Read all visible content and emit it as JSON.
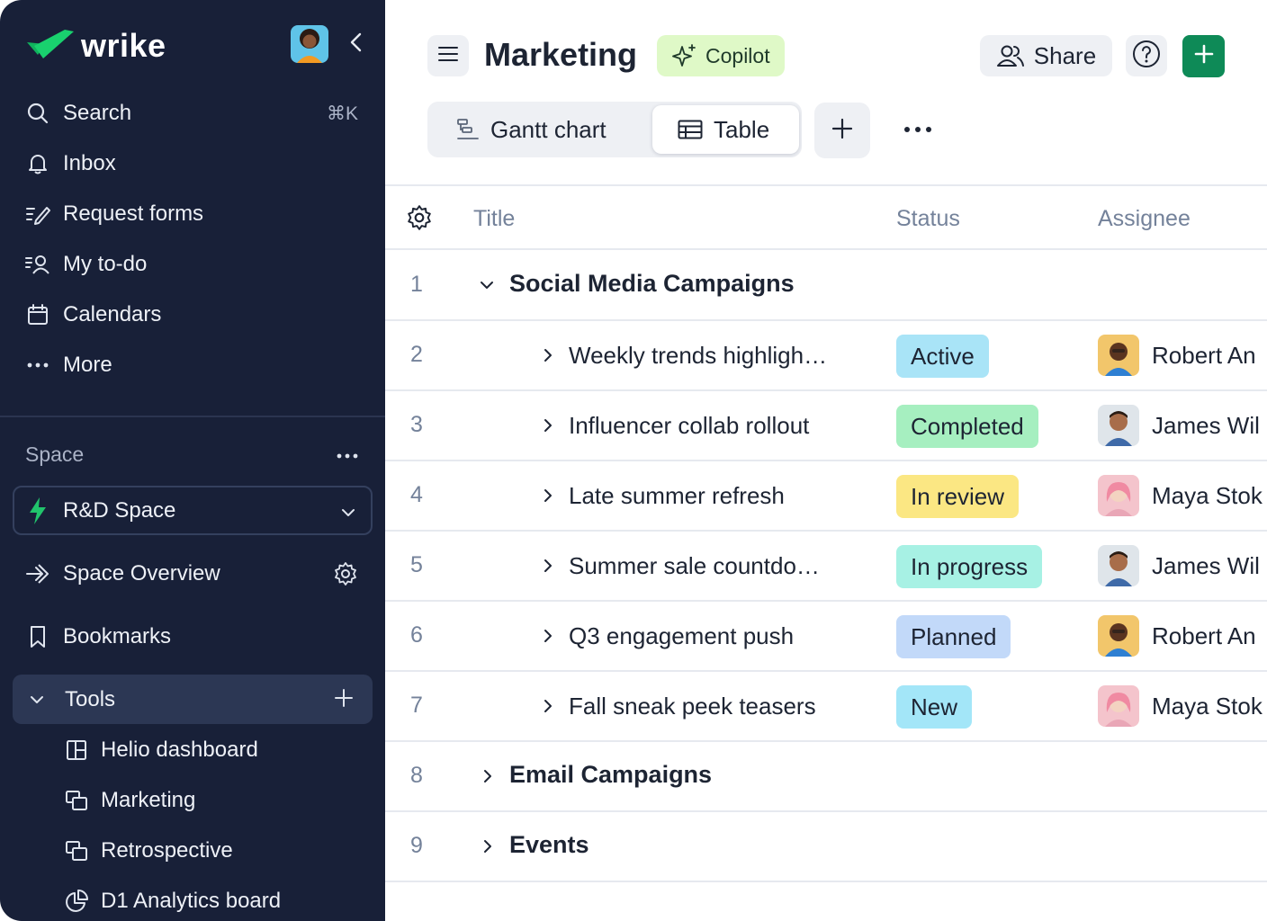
{
  "sidebar": {
    "brand": "wrike",
    "nav": [
      {
        "label": "Search",
        "shortcut": "⌘K",
        "icon": "search-icon"
      },
      {
        "label": "Inbox",
        "icon": "bell-icon"
      },
      {
        "label": "Request forms",
        "icon": "form-icon"
      },
      {
        "label": "My to-do",
        "icon": "todo-icon"
      },
      {
        "label": "Calendars",
        "icon": "calendar-icon"
      },
      {
        "label": "More",
        "icon": "more-dots-icon"
      }
    ],
    "space_label": "Space",
    "space_selected": "R&D Space",
    "overview_label": "Space Overview",
    "bookmarks_label": "Bookmarks",
    "tools_label": "Tools",
    "tools_items": [
      {
        "label": "Helio dashboard",
        "icon": "dashboard-icon"
      },
      {
        "label": "Marketing",
        "icon": "project-icon"
      },
      {
        "label": "Retrospective",
        "icon": "project-icon"
      },
      {
        "label": "D1 Analytics board",
        "icon": "pie-chart-icon"
      }
    ]
  },
  "header": {
    "title": "Marketing",
    "copilot_label": "Copilot",
    "share_label": "Share"
  },
  "views": {
    "tabs": [
      {
        "label": "Gantt chart",
        "active": false
      },
      {
        "label": "Table",
        "active": true
      }
    ]
  },
  "table": {
    "columns": [
      "Title",
      "Status",
      "Assignee"
    ],
    "rows": [
      {
        "num": "1",
        "type": "group",
        "title": "Social Media Campaigns",
        "expanded": true
      },
      {
        "num": "2",
        "type": "task",
        "title": "Weekly trends highligh…",
        "status": "Active",
        "assignee": "Robert An"
      },
      {
        "num": "3",
        "type": "task",
        "title": "Influencer collab rollout",
        "status": "Completed",
        "assignee": "James Wil"
      },
      {
        "num": "4",
        "type": "task",
        "title": "Late summer refresh",
        "status": "In review",
        "assignee": "Maya Stok"
      },
      {
        "num": "5",
        "type": "task",
        "title": "Summer sale countdo…",
        "status": "In progress",
        "assignee": "James Wil"
      },
      {
        "num": "6",
        "type": "task",
        "title": "Q3 engagement push",
        "status": "Planned",
        "assignee": "Robert An"
      },
      {
        "num": "7",
        "type": "task",
        "title": "Fall sneak peek teasers",
        "status": "New",
        "assignee": "Maya Stok"
      },
      {
        "num": "8",
        "type": "group",
        "title": "Email Campaigns",
        "expanded": false
      },
      {
        "num": "9",
        "type": "group",
        "title": "Events",
        "expanded": false
      }
    ]
  },
  "colors": {
    "sidebar_bg": "#182038",
    "accent_green": "#0e8a57",
    "status_active": "#a9e4f7",
    "status_completed": "#a6efc0",
    "status_in_review": "#fbe783",
    "status_in_progress": "#a7f1e4",
    "status_planned": "#c2d9f9",
    "status_new": "#a3e6f8"
  }
}
